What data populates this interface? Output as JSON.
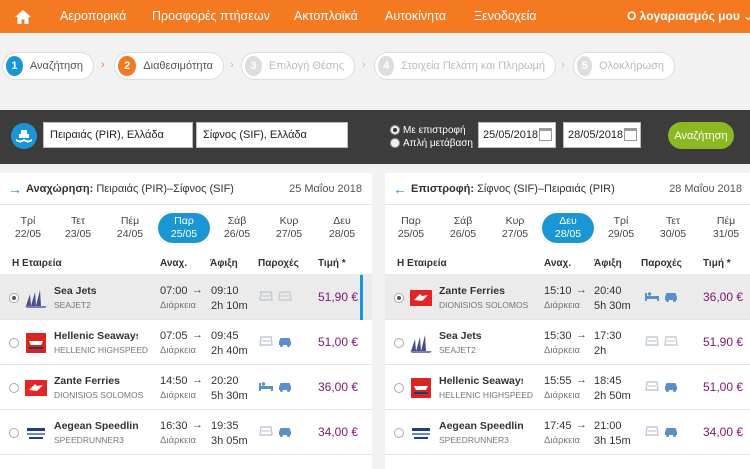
{
  "nav": {
    "items": [
      "Αεροπορικά",
      "Προσφορές πτήσεων",
      "Ακτοπλοϊκά",
      "Αυτοκίνητα",
      "Ξενοδοχεία"
    ],
    "account": "Ο λογαριασμός μου",
    "account_caret": "⌄"
  },
  "steps": [
    {
      "n": "1",
      "label": "Αναζήτηση",
      "color": "#1a96d4"
    },
    {
      "n": "2",
      "label": "Διαθεσιμότητα",
      "color": "#f47920"
    },
    {
      "n": "3",
      "label": "Επιλογή Θέσης"
    },
    {
      "n": "4",
      "label": "Στοιχεία Πελάτη και Πληρωμή"
    },
    {
      "n": "5",
      "label": "Ολοκλήρωση"
    }
  ],
  "search": {
    "from": "Πειραιάς (PIR), Ελλάδα",
    "to": "Σίφνος (SIF), Ελλάδα",
    "trip_return": "Με επιστροφή",
    "trip_oneway": "Απλή μετάβαση",
    "date_out": "25/05/2018",
    "date_back": "28/05/2018",
    "button": "Αναζήτηση"
  },
  "outbound": {
    "title": "Αναχώρηση:",
    "route": "Πειραιάς (PIR)–Σίφνος (SIF)",
    "date": "25 Μαΐου 2018",
    "days": [
      {
        "d": "Τρί",
        "dt": "22/05"
      },
      {
        "d": "Τετ",
        "dt": "23/05"
      },
      {
        "d": "Πέμ",
        "dt": "24/05"
      },
      {
        "d": "Παρ",
        "dt": "25/05"
      },
      {
        "d": "Σάβ",
        "dt": "26/05"
      },
      {
        "d": "Κυρ",
        "dt": "27/05"
      },
      {
        "d": "Δευ",
        "dt": "28/05"
      }
    ],
    "rows": [
      {
        "op": "Sea Jets",
        "vs": "SEAJET2",
        "dep": "07:00",
        "arr": "09:10",
        "dur": "2h 10m",
        "price": "51,90 €"
      },
      {
        "op": "Hellenic Seaways",
        "vs": "HELLENIC HIGHSPEED",
        "dep": "07:05",
        "arr": "09:45",
        "dur": "2h 40m",
        "price": "51,00 €"
      },
      {
        "op": "Zante Ferries",
        "vs": "DIONISIOS SOLOMOS",
        "dep": "14:50",
        "arr": "20:20",
        "dur": "5h 30m",
        "price": "36,00 €"
      },
      {
        "op": "Aegean Speedlines",
        "vs": "SPEEDRUNNER3",
        "dep": "16:30",
        "arr": "19:35",
        "dur": "3h 05m",
        "price": "34,00 €"
      }
    ]
  },
  "inbound": {
    "title": "Επιστροφή:",
    "route": "Σίφνος (SIF)–Πειραιάς (PIR)",
    "date": "28 Μαΐου 2018",
    "days": [
      {
        "d": "Παρ",
        "dt": "25/05"
      },
      {
        "d": "Σάβ",
        "dt": "26/05"
      },
      {
        "d": "Κυρ",
        "dt": "27/05"
      },
      {
        "d": "Δευ",
        "dt": "28/05"
      },
      {
        "d": "Τρί",
        "dt": "29/05"
      },
      {
        "d": "Τετ",
        "dt": "30/05"
      },
      {
        "d": "Πέμ",
        "dt": "31/05"
      }
    ],
    "rows": [
      {
        "op": "Zante Ferries",
        "vs": "DIONISIOS SOLOMOS",
        "dep": "15:10",
        "arr": "20:40",
        "dur": "5h 30m",
        "price": "36,00 €"
      },
      {
        "op": "Sea Jets",
        "vs": "SEAJET2",
        "dep": "15:30",
        "arr": "17:30",
        "dur": "2h",
        "price": "51,90 €"
      },
      {
        "op": "Hellenic Seaways",
        "vs": "HELLENIC HIGHSPEED",
        "dep": "15:55",
        "arr": "18:45",
        "dur": "2h 50m",
        "price": "51,00 €"
      },
      {
        "op": "Aegean Speedlines",
        "vs": "SPEEDRUNNER3",
        "dep": "17:45",
        "arr": "21:00",
        "dur": "3h 15m",
        "price": "34,00 €"
      }
    ]
  },
  "cols": {
    "company": "Η Εταιρεία",
    "dep": "Αναχ.",
    "arr": "Άφιξη",
    "amen": "Παροχές",
    "price": "Τιμή *"
  },
  "labels": {
    "duration": "Διάρκεια",
    "arrow": "→"
  }
}
